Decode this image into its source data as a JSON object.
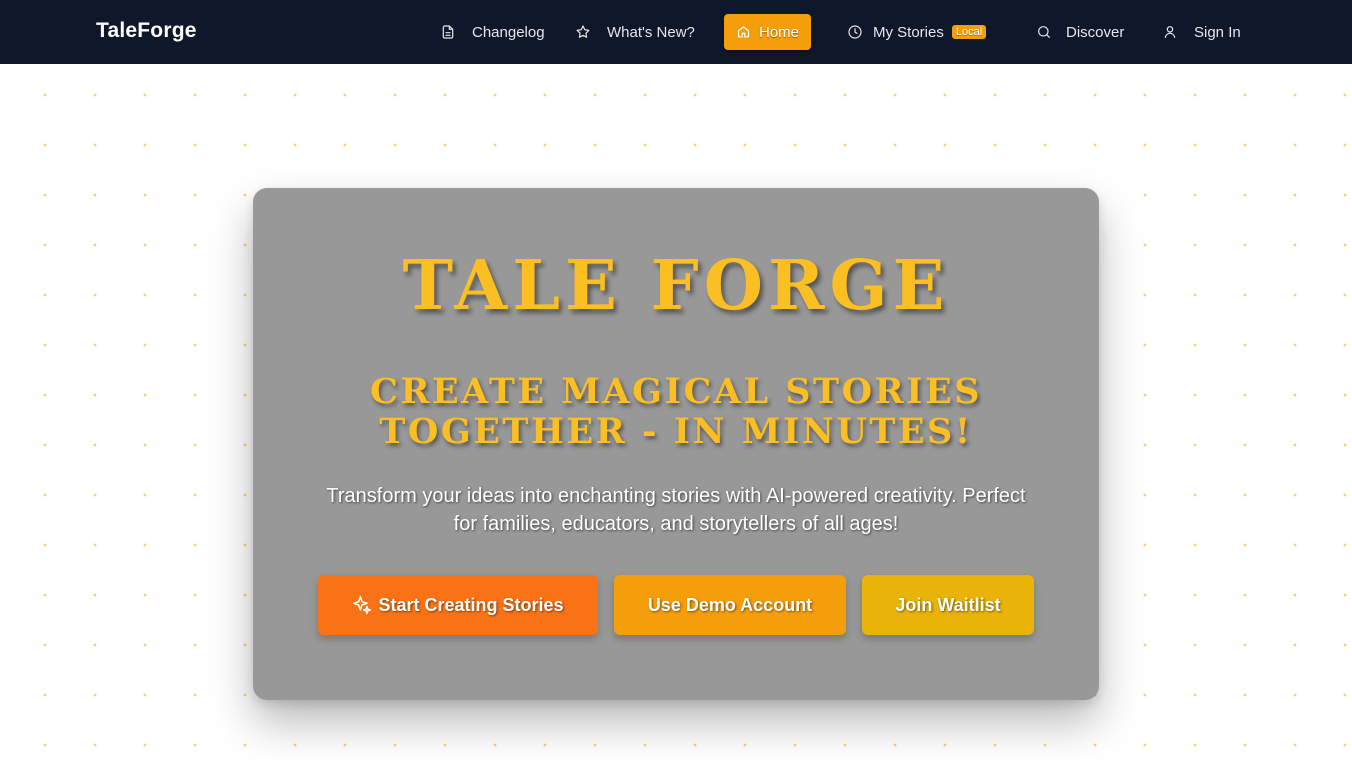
{
  "brand": "TaleForge",
  "nav": {
    "changelog": "Changelog",
    "whats_new": "What's New?",
    "home": "Home",
    "my_stories": "My Stories",
    "my_stories_badge": "Local",
    "discover": "Discover",
    "sign_in": "Sign In",
    "active_item": "Home"
  },
  "hero": {
    "title": "TALE FORGE",
    "subtitle": "CREATE MAGICAL STORIES TOGETHER - IN MINUTES!",
    "description": "Transform your ideas into enchanting stories with AI-powered creativity. Perfect for families, educators, and storytellers of all ages!",
    "buttons": {
      "start": "Start Creating Stories",
      "demo": "Use Demo Account",
      "waitlist": "Join Waitlist"
    }
  },
  "colors": {
    "navbar_bg": "#0f172a",
    "accent": "#f59e0b",
    "title_gold": "#fbbf24",
    "card_bg": "#989898",
    "btn_start": "#f97316",
    "btn_demo": "#f59e0b",
    "btn_waitlist": "#eab308"
  },
  "icons": {
    "changelog": "document-icon",
    "whats_new": "star-icon",
    "home": "home-icon",
    "my_stories": "clock-icon",
    "discover": "search-icon",
    "sign_in": "user-icon",
    "start": "sparkles-icon"
  }
}
